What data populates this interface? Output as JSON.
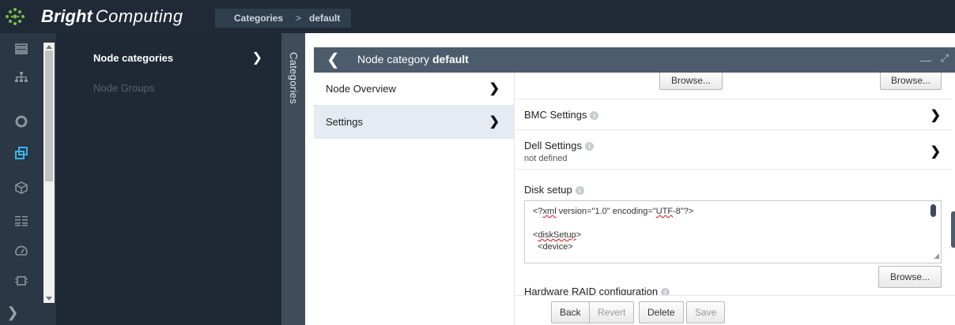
{
  "app": {
    "brand_bold": "Bright",
    "brand_light": "Computing"
  },
  "breadcrumb": {
    "first": "Categories",
    "separator": ">",
    "second": "default"
  },
  "rail": {
    "icons": [
      "servers-icon",
      "hierarchy-icon",
      "circle-icon",
      "categories-icon",
      "cube-icon",
      "list-icon",
      "gauge-icon",
      "chip-icon"
    ],
    "active": "categories-icon"
  },
  "tree": {
    "items": [
      {
        "label": "Node categories"
      },
      {
        "label": "Node Groups"
      }
    ]
  },
  "vertical_tab": {
    "label": "Categories"
  },
  "header": {
    "prefix": "Node category ",
    "name": "default"
  },
  "subnav": {
    "items": [
      {
        "label": "Node Overview"
      },
      {
        "label": "Settings"
      }
    ]
  },
  "content": {
    "browse_label": "Browse...",
    "bmc": {
      "title": "BMC Settings"
    },
    "dell": {
      "title": "Dell Settings",
      "value": "not defined"
    },
    "disk": {
      "title": "Disk setup",
      "line1_a": "<?",
      "line1_b": "xml",
      "line1_c": " version=\"1.0\" encoding=\"",
      "line1_d": "UTF",
      "line1_e": "-8\"?>",
      "line3_a": "<",
      "line3_b": "diskSetup",
      "line3_c": ">",
      "line4": "  <device>"
    },
    "hardware_raid": "Hardware RAID configuration"
  },
  "actions": {
    "back": "Back",
    "revert": "Revert",
    "delete": "Delete",
    "save": "Save"
  },
  "colors": {
    "topbar": "#1f2a36",
    "rail": "#2b3744",
    "tree": "#1e2935",
    "header": "#4c5c6c",
    "accent": "#3ab3e8",
    "selected_row": "#e4ebf2"
  }
}
